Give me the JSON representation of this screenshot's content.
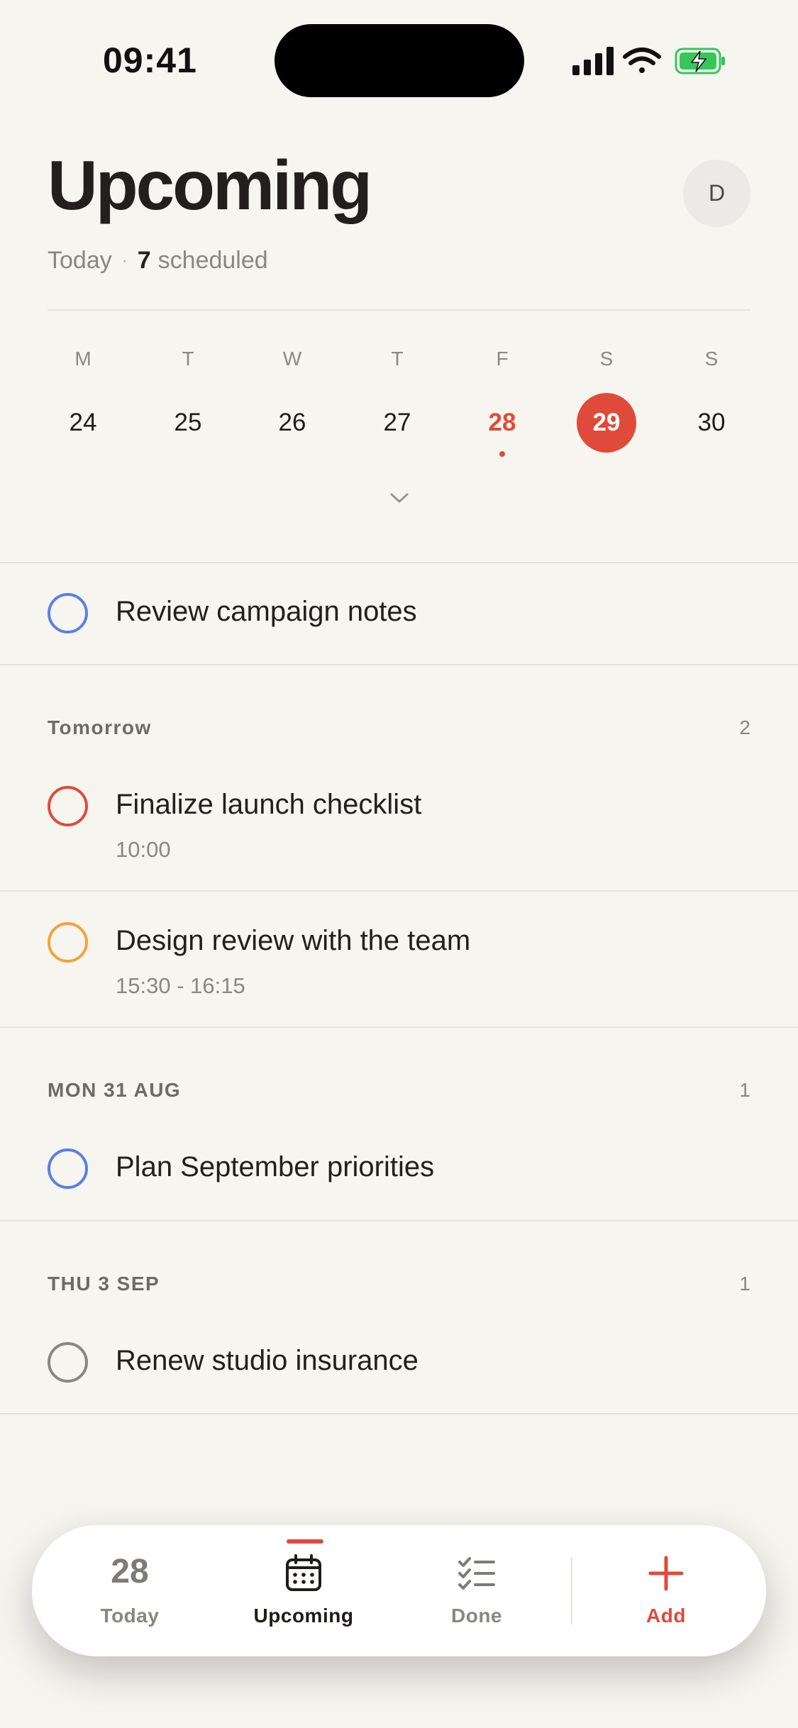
{
  "status_bar": {
    "time": "09:41"
  },
  "header": {
    "title": "Upcoming",
    "avatar_initial": "D",
    "subtitle_prefix": "Today",
    "subtitle_dot": "·",
    "scheduled_count": "7",
    "scheduled_suffix": "scheduled"
  },
  "week": {
    "days": [
      {
        "weekday": "M",
        "date": "24"
      },
      {
        "weekday": "T",
        "date": "25"
      },
      {
        "weekday": "W",
        "date": "26"
      },
      {
        "weekday": "T",
        "date": "27"
      },
      {
        "weekday": "F",
        "date": "28",
        "state": "today"
      },
      {
        "weekday": "S",
        "date": "29",
        "state": "selected"
      },
      {
        "weekday": "S",
        "date": "30"
      }
    ]
  },
  "tasks": {
    "today": [
      {
        "name": "Review campaign notes",
        "color": "#5B7FE3"
      }
    ],
    "tomorrow": {
      "label": "Tomorrow",
      "count": "2",
      "items": [
        {
          "name": "Finalize launch checklist",
          "time": "10:00",
          "color": "#E04A3A"
        },
        {
          "name": "Design review with the team",
          "time": "15:30 - 16:15",
          "color": "#F2A33A"
        }
      ]
    },
    "mon": {
      "label": "MON 31 AUG",
      "count": "1",
      "items": [
        {
          "name": "Plan September priorities",
          "color": "#5B7FE3"
        }
      ]
    },
    "thu": {
      "label": "THU 3 SEP",
      "count": "1",
      "items": [
        {
          "name": "Renew studio insurance",
          "color": "#8A8681"
        }
      ]
    }
  },
  "tabbar": {
    "today_date": "28",
    "today_label": "Today",
    "upcoming_label": "Upcoming",
    "done_label": "Done",
    "add_label": "Add"
  },
  "colors": {
    "accent": "#E04A3A",
    "background": "#F7F5F0",
    "text": "#221F1C"
  }
}
